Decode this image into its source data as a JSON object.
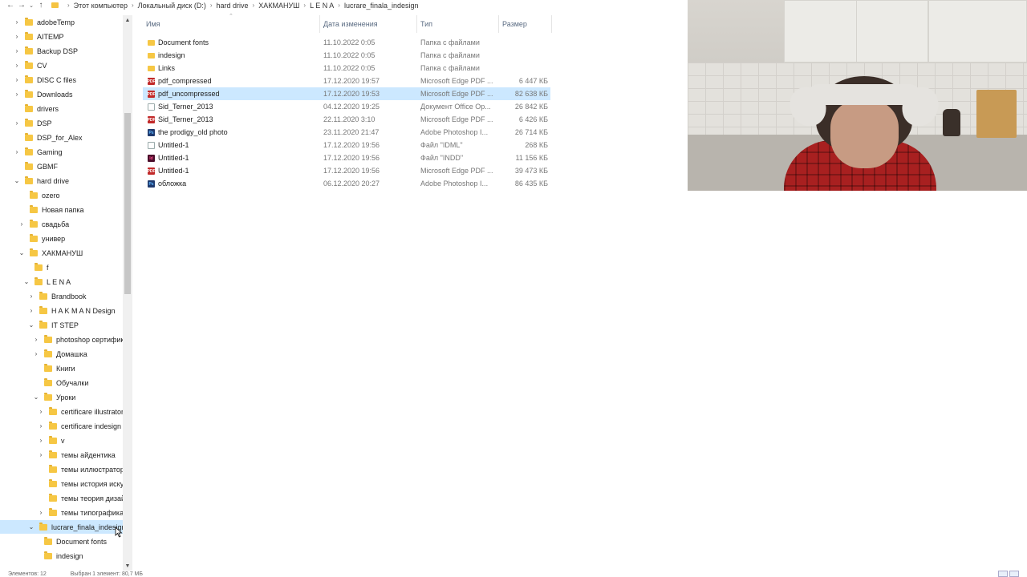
{
  "address_bar": {
    "back_icon": "arrow-left-icon",
    "forward_icon": "arrow-right-icon",
    "recent_icon": "chevron-down-icon",
    "up_icon": "arrow-up-icon",
    "path": [
      "Этот компьютер",
      "Локальный диск (D:)",
      "hard drive",
      "ХАКМАНУШ",
      "L E N A",
      "lucrare_finala_indesign"
    ]
  },
  "nav_tree": [
    {
      "label": "adobeTemp",
      "level": 0,
      "expander": "collapsed"
    },
    {
      "label": "AITEMP",
      "level": 0,
      "expander": "collapsed"
    },
    {
      "label": "Backup DSP",
      "level": 0,
      "expander": "collapsed"
    },
    {
      "label": "CV",
      "level": 0,
      "expander": "collapsed"
    },
    {
      "label": "DISC C files",
      "level": 0,
      "expander": "collapsed"
    },
    {
      "label": "Downloads",
      "level": 0,
      "expander": "collapsed"
    },
    {
      "label": "drivers",
      "level": 0,
      "expander": "none"
    },
    {
      "label": "DSP",
      "level": 0,
      "expander": "collapsed"
    },
    {
      "label": "DSP_for_Alex",
      "level": 0,
      "expander": "none"
    },
    {
      "label": "Gaming",
      "level": 0,
      "expander": "collapsed"
    },
    {
      "label": "GBMF",
      "level": 0,
      "expander": "none"
    },
    {
      "label": "hard drive",
      "level": 0,
      "expander": "expanded"
    },
    {
      "label": "ozero",
      "level": 1,
      "expander": "none"
    },
    {
      "label": "Новая папка",
      "level": 1,
      "expander": "none"
    },
    {
      "label": "свадьба",
      "level": 1,
      "expander": "collapsed"
    },
    {
      "label": "универ",
      "level": 1,
      "expander": "none"
    },
    {
      "label": "ХАКМАНУШ",
      "level": 1,
      "expander": "expanded"
    },
    {
      "label": "f",
      "level": 2,
      "expander": "none"
    },
    {
      "label": "L E N A",
      "level": 2,
      "expander": "expanded"
    },
    {
      "label": "Brandbook",
      "level": 3,
      "expander": "collapsed"
    },
    {
      "label": "H A K M A N Design",
      "level": 3,
      "expander": "collapsed"
    },
    {
      "label": "IT STEP",
      "level": 3,
      "expander": "expanded"
    },
    {
      "label": "photoshop сертифик",
      "level": 4,
      "expander": "collapsed"
    },
    {
      "label": "Домашка",
      "level": 4,
      "expander": "collapsed"
    },
    {
      "label": "Книги",
      "level": 4,
      "expander": "none"
    },
    {
      "label": "Обучалки",
      "level": 4,
      "expander": "none"
    },
    {
      "label": "Уроки",
      "level": 4,
      "expander": "expanded"
    },
    {
      "label": "certificare illustrator",
      "level": 5,
      "expander": "collapsed"
    },
    {
      "label": "certificare indesign",
      "level": 5,
      "expander": "collapsed"
    },
    {
      "label": "v",
      "level": 5,
      "expander": "collapsed"
    },
    {
      "label": "темы айдентика",
      "level": 5,
      "expander": "collapsed"
    },
    {
      "label": "темы иллюстратор",
      "level": 5,
      "expander": "none"
    },
    {
      "label": "темы история искус",
      "level": 5,
      "expander": "none"
    },
    {
      "label": "темы теория дизай",
      "level": 5,
      "expander": "none"
    },
    {
      "label": "темы типографика",
      "level": 5,
      "expander": "collapsed"
    },
    {
      "label": "lucrare_finala_indesign",
      "level": 3,
      "expander": "expanded",
      "selected": true
    },
    {
      "label": "Document fonts",
      "level": 4,
      "expander": "none"
    },
    {
      "label": "indesign",
      "level": 4,
      "expander": "none"
    }
  ],
  "columns": {
    "name": "Имя",
    "date": "Дата изменения",
    "type": "Тип",
    "size": "Размер"
  },
  "files": [
    {
      "name": "Document fonts",
      "date": "11.10.2022 0:05",
      "type": "Папка с файлами",
      "size": "",
      "icon": "folder"
    },
    {
      "name": "indesign",
      "date": "11.10.2022 0:05",
      "type": "Папка с файлами",
      "size": "",
      "icon": "folder"
    },
    {
      "name": "Links",
      "date": "11.10.2022 0:05",
      "type": "Папка с файлами",
      "size": "",
      "icon": "folder"
    },
    {
      "name": "pdf_compressed",
      "date": "17.12.2020 19:57",
      "type": "Microsoft Edge PDF ...",
      "size": "6 447 КБ",
      "icon": "pdf"
    },
    {
      "name": "pdf_uncompressed",
      "date": "17.12.2020 19:53",
      "type": "Microsoft Edge PDF ...",
      "size": "82 638 КБ",
      "icon": "pdf",
      "selected": true
    },
    {
      "name": "Sid_Terner_2013",
      "date": "04.12.2020 19:25",
      "type": "Документ Office Op...",
      "size": "26 842 КБ",
      "icon": "doc"
    },
    {
      "name": "Sid_Terner_2013",
      "date": "22.11.2020 3:10",
      "type": "Microsoft Edge PDF ...",
      "size": "6 426 КБ",
      "icon": "pdf"
    },
    {
      "name": "the prodigy_old photo",
      "date": "23.11.2020 21:47",
      "type": "Adobe Photoshop I...",
      "size": "26 714 КБ",
      "icon": "psd"
    },
    {
      "name": "Untitled-1",
      "date": "17.12.2020 19:56",
      "type": "Файл \"IDML\"",
      "size": "268 КБ",
      "icon": "idml"
    },
    {
      "name": "Untitled-1",
      "date": "17.12.2020 19:56",
      "type": "Файл \"INDD\"",
      "size": "11 156 КБ",
      "icon": "indd"
    },
    {
      "name": "Untitled-1",
      "date": "17.12.2020 19:56",
      "type": "Microsoft Edge PDF ...",
      "size": "39 473 КБ",
      "icon": "pdf"
    },
    {
      "name": "обложка",
      "date": "06.12.2020 20:27",
      "type": "Adobe Photoshop I...",
      "size": "86 435 КБ",
      "icon": "psd"
    }
  ],
  "status_bar": {
    "item_count": "Элементов: 12",
    "selected_info": "Выбран 1 элемент: 80,7 МБ"
  },
  "colors": {
    "selection": "#cce8ff",
    "folder": "#f6c744",
    "header_text": "#5a6b82"
  }
}
